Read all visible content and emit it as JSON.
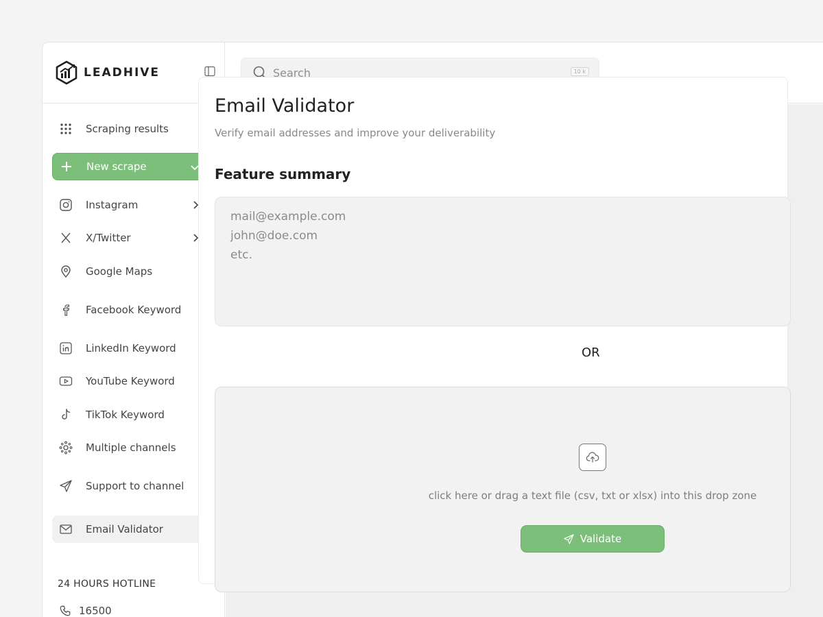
{
  "brand": {
    "name": "LEADHIVE",
    "logo_icon": "hexagon-chart-logo",
    "collapse_icon": "sidebar-toggle-icon"
  },
  "search": {
    "placeholder": "Search",
    "shortcut": "10 k"
  },
  "sidebar": {
    "items": [
      {
        "label": "Scraping results",
        "icon": "grid-dots-icon"
      },
      {
        "label": "New scrape",
        "icon": "plus-icon"
      },
      {
        "label": "Instagram",
        "icon": "instagram-icon"
      },
      {
        "label": "X/Twitter",
        "icon": "x-icon"
      },
      {
        "label": "Google Maps",
        "icon": "map-pin-icon"
      },
      {
        "label": "Facebook Keyword",
        "icon": "facebook-icon"
      },
      {
        "label": "LinkedIn Keyword",
        "icon": "linkedin-icon"
      },
      {
        "label": "YouTube Keyword",
        "icon": "youtube-icon"
      },
      {
        "label": "TikTok Keyword",
        "icon": "tiktok-icon"
      },
      {
        "label": "Multiple channels",
        "icon": "network-icon"
      },
      {
        "label": "Support to channel",
        "icon": "send-icon"
      },
      {
        "label": "Email Validator",
        "icon": "mail-icon"
      }
    ],
    "hotline_title": "24 HOURS HOTLINE",
    "hotline_number": "16500"
  },
  "main": {
    "title": "Email Validator",
    "subtitle": "Verify email addresses and improve your deliverability",
    "section_title": "Feature summary",
    "emails_placeholder": "mail@example.com\njohn@doe.com\netc.",
    "or_label": "OR",
    "drop_text": "click here or drag a text file (csv, txt or xlsx) into this drop zone",
    "validate_label": "Validate"
  },
  "colors": {
    "accent": "#7cbf7a",
    "background": "#f4f4f4",
    "panel": "#eeefee"
  }
}
